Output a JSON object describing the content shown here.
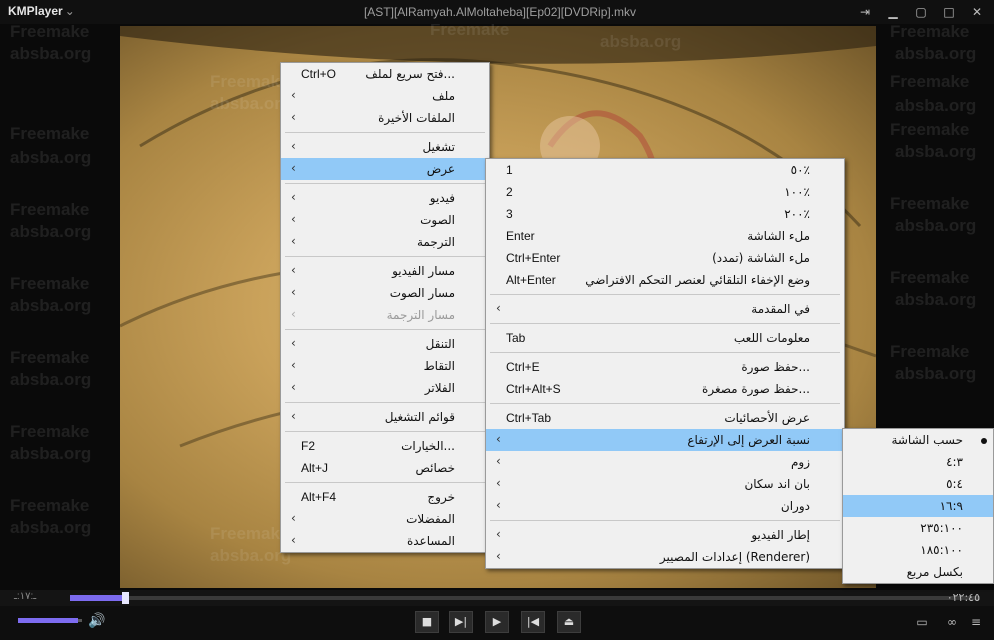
{
  "app": {
    "name": "KMPlayer",
    "logo_suffix": "⌄",
    "window_title": "[AST][AlRamyah.AlMoltaheba][Ep02][DVDRip].mkv"
  },
  "window_controls": [
    "pin-icon",
    "minimize-icon",
    "restore-icon",
    "maximize-icon",
    "close-icon"
  ],
  "watermarks": {
    "freemake": "Freemake",
    "absba": "absba.org"
  },
  "playback": {
    "elapsed_time": "ـ:۱۷:ـ",
    "total_time": "۰۲۲:٤٥",
    "progress_fraction": 0.06,
    "volume_fraction": 0.93
  },
  "main_menu": {
    "items": [
      {
        "label": "فتح سريع لملف...",
        "shortcut": "Ctrl+O",
        "arrow": false
      },
      {
        "label": "ملف",
        "shortcut": "",
        "arrow": true
      },
      {
        "label": "الملفات الأخيرة",
        "shortcut": "",
        "arrow": true
      },
      {
        "sep": true
      },
      {
        "label": "تشغيل",
        "shortcut": "",
        "arrow": true
      },
      {
        "label": "عرض",
        "shortcut": "",
        "arrow": true,
        "selected": true
      },
      {
        "sep": true
      },
      {
        "label": "فيديو",
        "shortcut": "",
        "arrow": true
      },
      {
        "label": "الصوت",
        "shortcut": "",
        "arrow": true
      },
      {
        "label": "الترجمة",
        "shortcut": "",
        "arrow": true
      },
      {
        "sep": true
      },
      {
        "label": "مسار الفيديو",
        "shortcut": "",
        "arrow": true
      },
      {
        "label": "مسار الصوت",
        "shortcut": "",
        "arrow": true
      },
      {
        "label": "مسار الترجمة",
        "shortcut": "",
        "arrow": true,
        "disabled": true
      },
      {
        "sep": true
      },
      {
        "label": "التنقل",
        "shortcut": "",
        "arrow": true
      },
      {
        "label": "التقاط",
        "shortcut": "",
        "arrow": true
      },
      {
        "label": "الفلاتر",
        "shortcut": "",
        "arrow": true
      },
      {
        "sep": true
      },
      {
        "label": "قوائم التشغيل",
        "shortcut": "",
        "arrow": true
      },
      {
        "sep": true
      },
      {
        "label": "الخيارات...",
        "shortcut": "F2",
        "arrow": false
      },
      {
        "label": "خصائص",
        "shortcut": "Alt+J",
        "arrow": false
      },
      {
        "sep": true
      },
      {
        "label": "خروج",
        "shortcut": "Alt+F4",
        "arrow": false
      },
      {
        "label": "المفضلات",
        "shortcut": "",
        "arrow": true
      },
      {
        "label": "المساعدة",
        "shortcut": "",
        "arrow": true
      }
    ]
  },
  "view_menu": {
    "items": [
      {
        "label": "٥٠٪",
        "shortcut": "1",
        "arrow": false
      },
      {
        "label": "١٠٠٪",
        "shortcut": "2",
        "arrow": false
      },
      {
        "label": "٢٠٠٪",
        "shortcut": "3",
        "arrow": false
      },
      {
        "label": "ملء الشاشة",
        "shortcut": "Enter",
        "arrow": false
      },
      {
        "label": "ملء الشاشة (تمدد)",
        "shortcut": "Ctrl+Enter",
        "arrow": false
      },
      {
        "label": "وضع الإخفاء التلقائي لعنصر التحكم الافتراضي",
        "shortcut": "Alt+Enter",
        "arrow": false
      },
      {
        "sep": true
      },
      {
        "label": "في المقدمة",
        "shortcut": "",
        "arrow": true
      },
      {
        "sep": true
      },
      {
        "label": "معلومات اللعب",
        "shortcut": "Tab",
        "arrow": false
      },
      {
        "sep": true
      },
      {
        "label": "حفظ صورة...",
        "shortcut": "Ctrl+E",
        "arrow": false
      },
      {
        "label": "حفظ صورة مصغرة...",
        "shortcut": "Ctrl+Alt+S",
        "arrow": false
      },
      {
        "sep": true
      },
      {
        "label": "عرض الأحصائيات",
        "shortcut": "Ctrl+Tab",
        "arrow": false
      },
      {
        "label": "نسبة العرض إلى الإرتفاع",
        "shortcut": "",
        "arrow": true,
        "selected": true
      },
      {
        "label": "زوم",
        "shortcut": "",
        "arrow": true
      },
      {
        "label": "بان اند سكان",
        "shortcut": "",
        "arrow": true
      },
      {
        "label": "دوران",
        "shortcut": "",
        "arrow": true
      },
      {
        "sep": true
      },
      {
        "label": "إطار الفيديو",
        "shortcut": "",
        "arrow": true
      },
      {
        "label": "إعدادات المصيير (Renderer)",
        "shortcut": "",
        "arrow": true
      }
    ]
  },
  "aspect_menu": {
    "items": [
      {
        "label": "حسب الشاشة",
        "checked": true
      },
      {
        "label": "٤:٣"
      },
      {
        "label": "٥:٤"
      },
      {
        "label": "١٦:٩",
        "selected": true
      },
      {
        "label": "٢٣٥:١٠٠"
      },
      {
        "label": "١٨٥:١٠٠"
      },
      {
        "label": "بكسل مربع"
      }
    ]
  },
  "colors": {
    "accent": "#7d6cf0",
    "menu_bg": "#f0f0f0",
    "menu_selected": "#91c9f7"
  }
}
